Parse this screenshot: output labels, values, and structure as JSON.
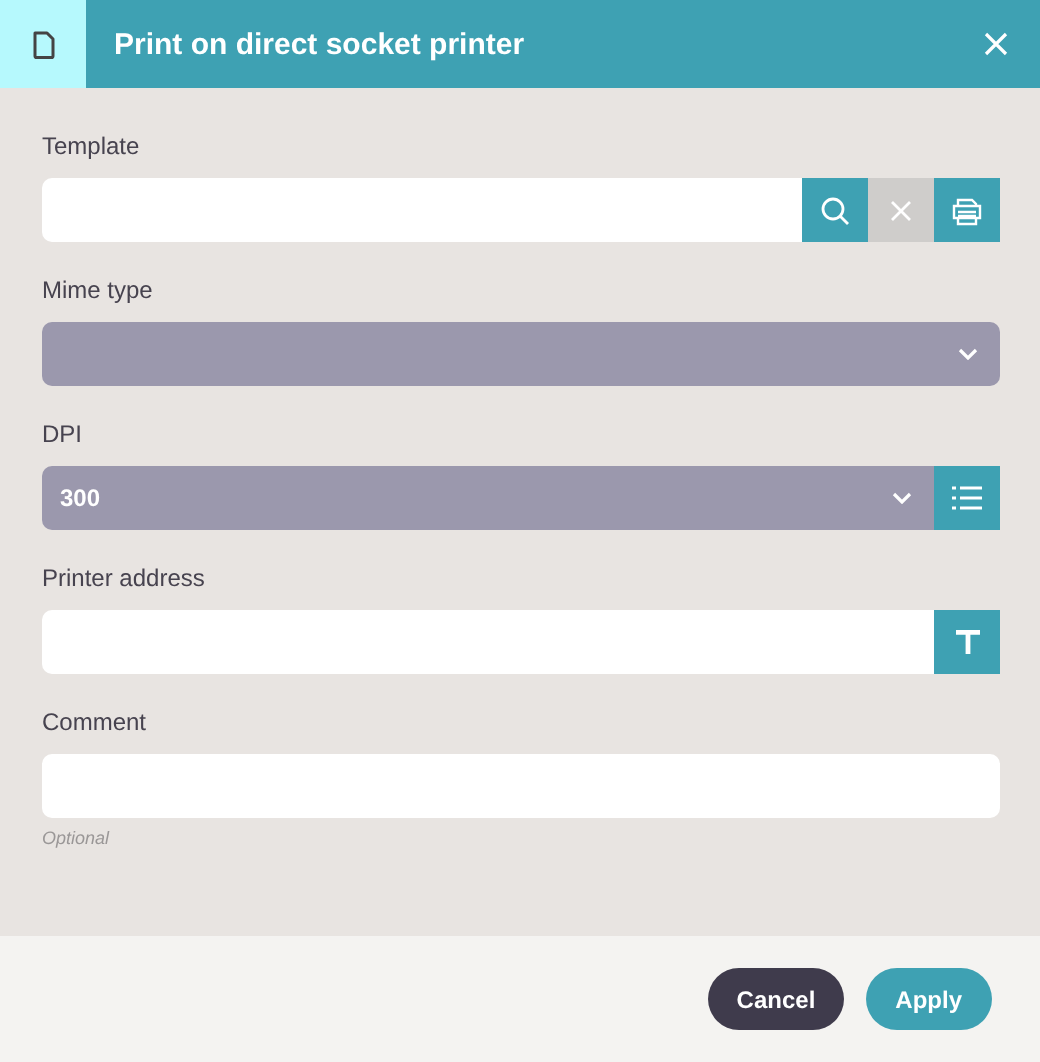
{
  "window": {
    "title": "Print on direct socket printer"
  },
  "fields": [
    {
      "kind": "text",
      "label": "Template",
      "buttons": [
        {
          "kind": "search",
          "disabled": false
        },
        {
          "kind": "clear",
          "disabled": true
        },
        {
          "kind": "printer",
          "disabled": false
        }
      ]
    },
    {
      "kind": "select",
      "label": "Mime type"
    },
    {
      "kind": "select",
      "label": "DPI",
      "value": "300",
      "buttons": [
        {
          "kind": "list",
          "disabled": false
        }
      ]
    },
    {
      "kind": "text",
      "label": "Printer address",
      "buttons": [
        {
          "kind": "text",
          "disabled": false
        }
      ]
    },
    {
      "kind": "text",
      "label": "Comment",
      "hint": "Optional"
    }
  ],
  "buttons": [
    {
      "label": "Cancel",
      "kind": "secondary"
    },
    {
      "label": "Apply",
      "kind": "primary"
    }
  ]
}
